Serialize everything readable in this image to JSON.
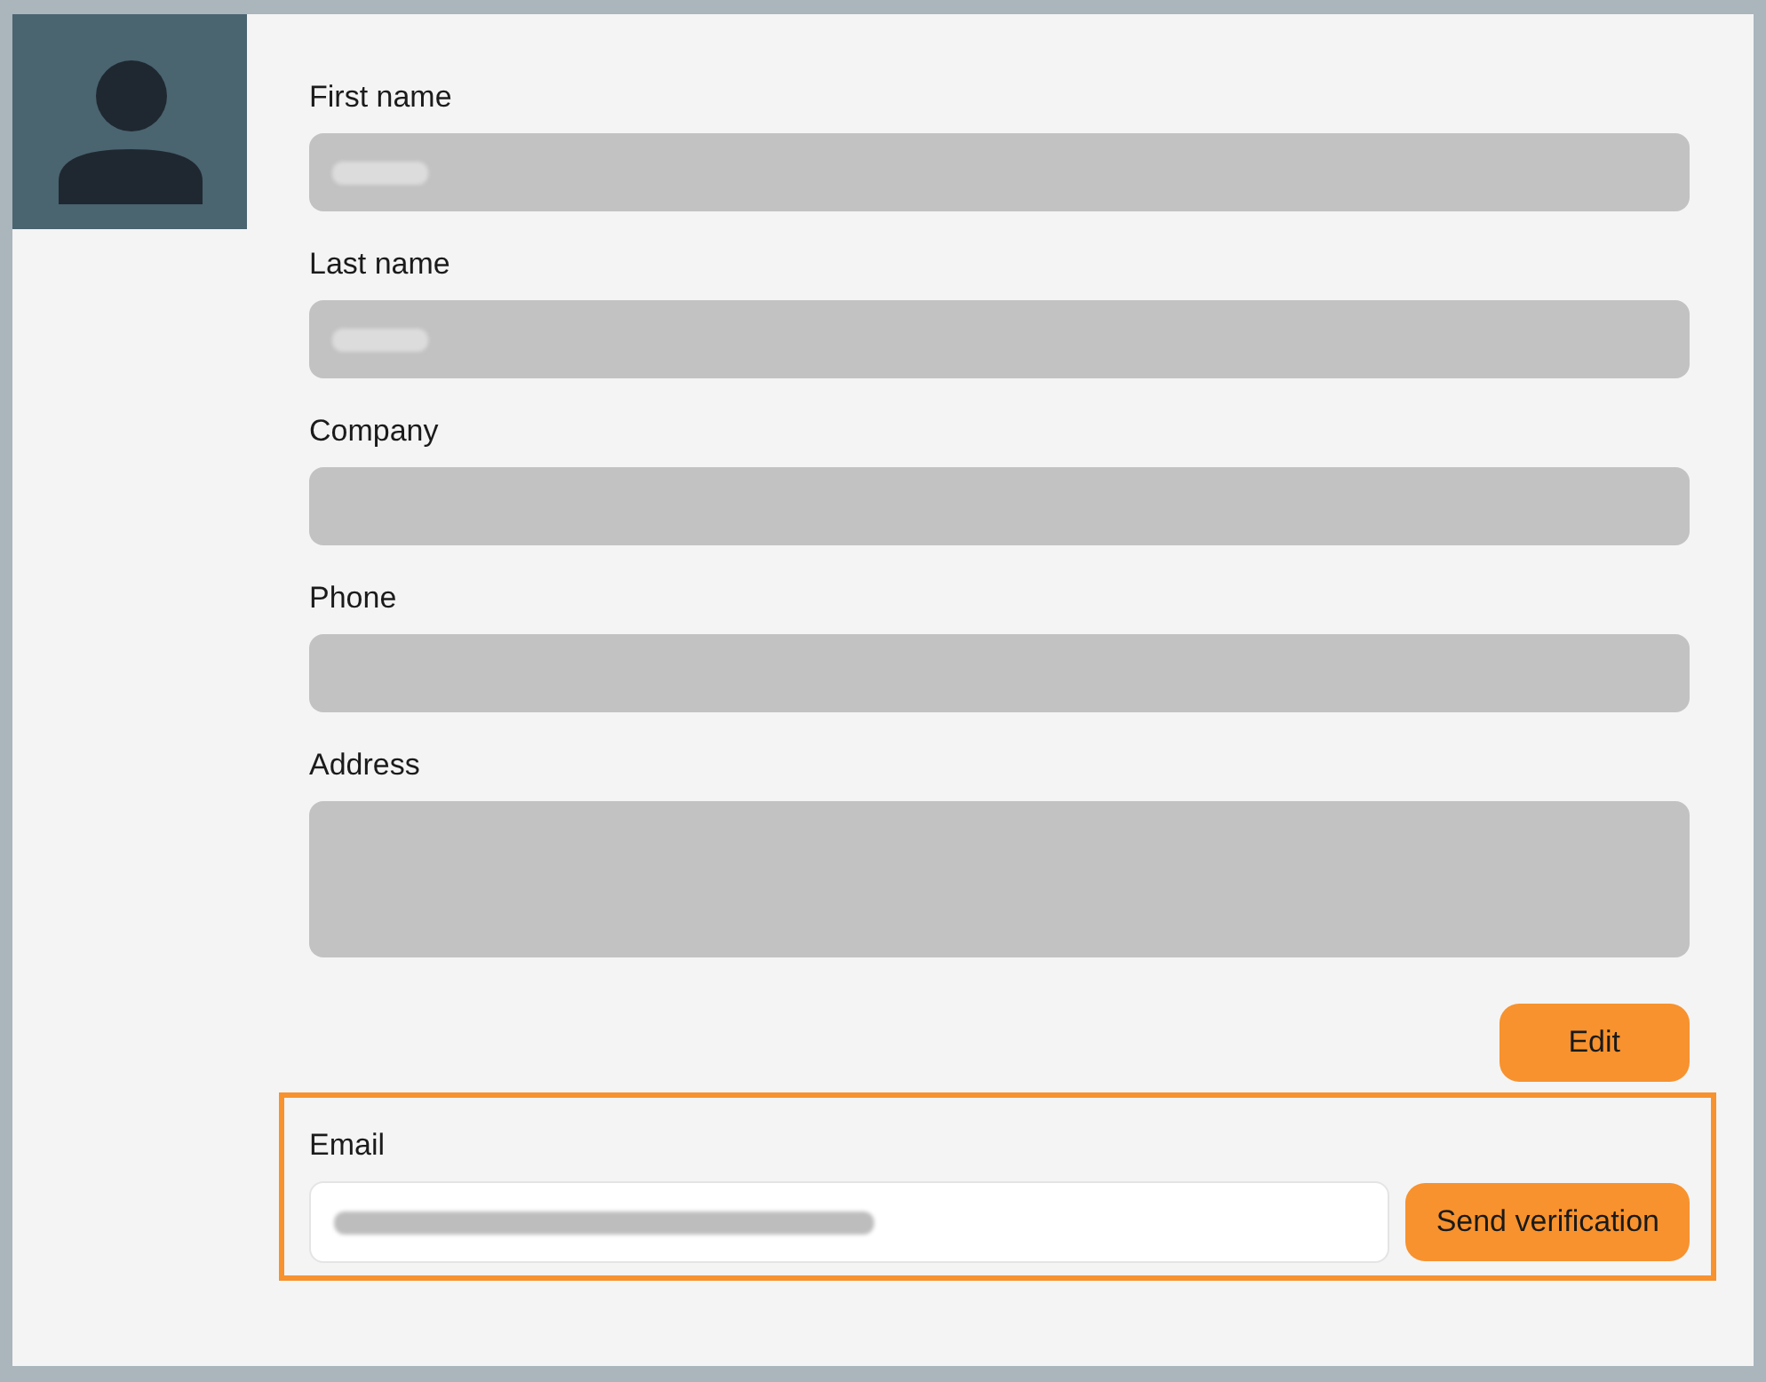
{
  "fields": [
    {
      "label": "First name",
      "kind": "text",
      "disabled": true,
      "value_blurred": true
    },
    {
      "label": "Last name",
      "kind": "text",
      "disabled": true,
      "value_blurred": true
    },
    {
      "label": "Company",
      "kind": "text",
      "disabled": true
    },
    {
      "label": "Phone",
      "kind": "text",
      "disabled": true
    },
    {
      "label": "Address",
      "kind": "textarea",
      "disabled": true
    }
  ],
  "edit_button": {
    "label": "Edit"
  },
  "email": {
    "label": "Email",
    "highlighted": true,
    "disabled": false,
    "value_blurred": true,
    "button": "Send verification"
  }
}
